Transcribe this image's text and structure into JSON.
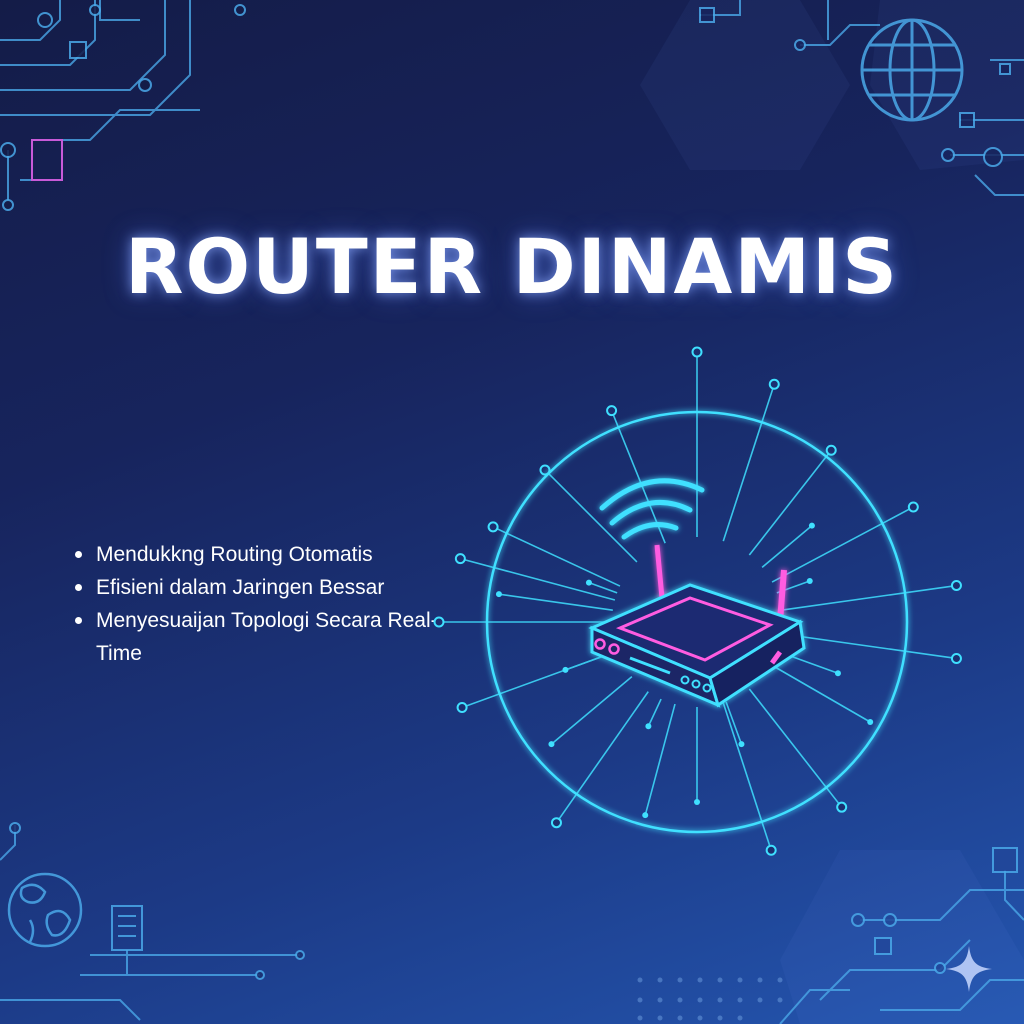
{
  "title": "ROUTER DINAMIS",
  "features": [
    "Mendukkng Routing Otomatis",
    "Efisieni dalam Jaringen Bessar",
    "Menyesuaijan Topologi Secara Real-Time"
  ],
  "icons": [
    "globe-icon",
    "router-icon",
    "wifi-icon",
    "server-icon",
    "sparkle-icon"
  ],
  "colors": {
    "background_top": "#141c48",
    "background_bottom": "#2456b0",
    "neon_cyan": "#3fe0ff",
    "neon_pink": "#ff5ce1",
    "circuit": "#4aa8e8"
  }
}
